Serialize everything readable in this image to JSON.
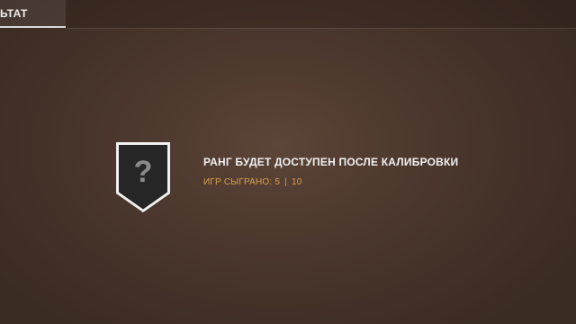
{
  "header": {
    "tab_label": "ЬТАТ"
  },
  "rank": {
    "badge_symbol": "?",
    "status_text": "РАНГ БУДЕТ ДОСТУПЕН ПОСЛЕ КАЛИБРОВКИ",
    "games_played_label": "ИГР СЫГРАНО:",
    "games_played": "5",
    "games_separator": "|",
    "games_required": "10"
  },
  "colors": {
    "accent": "#d9a24a",
    "background": "#4b372d",
    "badge_fill": "#262626"
  }
}
